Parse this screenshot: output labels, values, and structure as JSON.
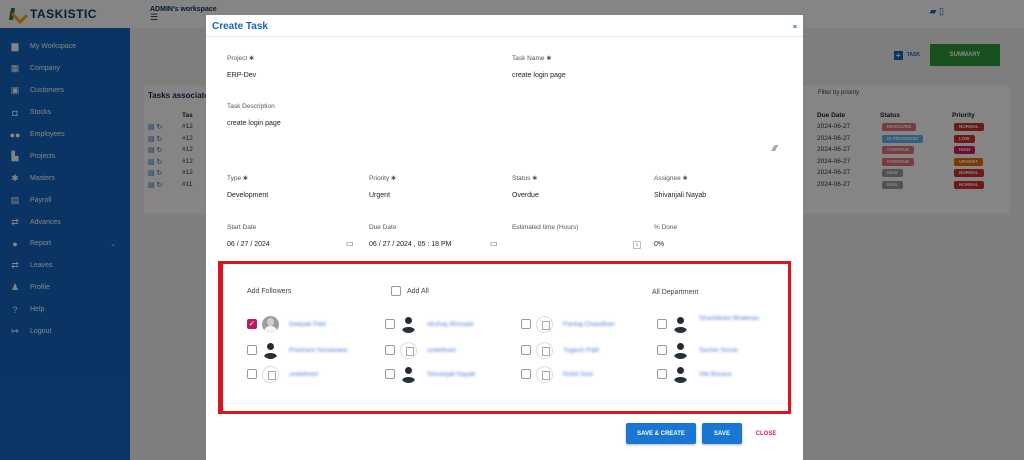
{
  "brand": {
    "name": "TASKISTIC"
  },
  "sidebar": {
    "items": [
      {
        "label": "My Workspace",
        "icon": "briefcase-icon"
      },
      {
        "label": "Company",
        "icon": "store-icon"
      },
      {
        "label": "Customers",
        "icon": "contact-card-icon"
      },
      {
        "label": "Stocks",
        "icon": "box-icon"
      },
      {
        "label": "Employees",
        "icon": "people-icon"
      },
      {
        "label": "Projects",
        "icon": "building-icon"
      },
      {
        "label": "Masters",
        "icon": "gear-icon"
      },
      {
        "label": "Payroll",
        "icon": "calendar-icon"
      },
      {
        "label": "Advances",
        "icon": "arrows-icon"
      },
      {
        "label": "Report",
        "icon": "info-icon",
        "expandable": true
      },
      {
        "label": "Leaves",
        "icon": "arrows-icon"
      },
      {
        "label": "Profile",
        "icon": "user-gear-icon"
      },
      {
        "label": "Help",
        "icon": "help-icon"
      },
      {
        "label": "Logout",
        "icon": "logout-icon"
      }
    ]
  },
  "background": {
    "workspace_title": "ADMIN's workspace",
    "task_button": "TASK",
    "summary_button": "SUMMARY",
    "card_title": "Tasks associate",
    "filter_label": "Filter by priority",
    "table_headers": {
      "task": "Tas",
      "due": "Due Date",
      "status": "Status",
      "priority": "Priority"
    },
    "rows": [
      {
        "id": "#12",
        "due": "2024-06-27",
        "status": "RESOLVED",
        "status_color": "#e57373",
        "priority": "NORMAL",
        "priority_color": "#d32f2f"
      },
      {
        "id": "#12",
        "due": "2024-06-27",
        "status": "IN PROGRESS",
        "status_color": "#64b5f6",
        "priority": "LOW",
        "priority_color": "#d32f2f"
      },
      {
        "id": "#12",
        "due": "2024-06-27",
        "status": "OVERDUE",
        "status_color": "#e57373",
        "priority": "HIGH",
        "priority_color": "#d81b60"
      },
      {
        "id": "#12",
        "due": "2024-06-27",
        "status": "OVERDUE",
        "status_color": "#e57373",
        "priority": "URGENT",
        "priority_color": "#ef6c00"
      },
      {
        "id": "#12",
        "due": "2024-06-27",
        "status": "NEW",
        "status_color": "#9e9e9e",
        "priority": "NORMAL",
        "priority_color": "#d32f2f"
      },
      {
        "id": "#11",
        "due": "2024-06-27",
        "status": "NEW",
        "status_color": "#9e9e9e",
        "priority": "NORMAL",
        "priority_color": "#d32f2f"
      }
    ]
  },
  "modal": {
    "title": "Create Task",
    "close_x": "×",
    "project": {
      "label": "Project",
      "value": "ERP-Dev"
    },
    "task_name": {
      "label": "Task Name",
      "value": "create login page"
    },
    "description": {
      "label": "Task Description",
      "value": "create login page"
    },
    "type": {
      "label": "Type",
      "value": "Development"
    },
    "priority": {
      "label": "Priority",
      "value": "Urgent"
    },
    "status": {
      "label": "Status",
      "value": "Overdue"
    },
    "assignee": {
      "label": "Assignee",
      "value": "Shivanjali Nayab"
    },
    "start_date": {
      "label": "Start Date",
      "value": "06 / 27 / 2024"
    },
    "due_date": {
      "label": "Due Date",
      "value": "06 / 27 / 2024 , 05 : 18  PM"
    },
    "estimated": {
      "label": "Estimated time (Hours)",
      "value": ""
    },
    "done": {
      "label": "% Done",
      "value": "0%"
    },
    "followers": {
      "add_label": "Add Followers",
      "add_all_label": "Add All",
      "department_label": "All Department",
      "people": [
        {
          "name": "Deepak Patil",
          "checked": true,
          "avatar": "photo"
        },
        {
          "name": "Akshay Bhosale",
          "checked": false,
          "avatar": "person"
        },
        {
          "name": "Pankaj Chaudhari",
          "checked": false,
          "avatar": "broken"
        },
        {
          "name": "Shashikant Bhalerao",
          "checked": false,
          "avatar": "person"
        },
        {
          "name": "Prashant Sonawane",
          "checked": false,
          "avatar": "person"
        },
        {
          "name": "undefined",
          "checked": false,
          "avatar": "broken"
        },
        {
          "name": "Yogesh Patil",
          "checked": false,
          "avatar": "broken"
        },
        {
          "name": "Sachin Sonar",
          "checked": false,
          "avatar": "person"
        },
        {
          "name": "undefined",
          "checked": false,
          "avatar": "broken"
        },
        {
          "name": "Shivanjali Nayab",
          "checked": false,
          "avatar": "person"
        },
        {
          "name": "Rohit Soni",
          "checked": false,
          "avatar": "broken"
        },
        {
          "name": "Viki Borase",
          "checked": false,
          "avatar": "person"
        }
      ]
    },
    "buttons": {
      "save_create": "SAVE & CREATE",
      "save": "SAVE",
      "close": "CLOSE"
    }
  }
}
